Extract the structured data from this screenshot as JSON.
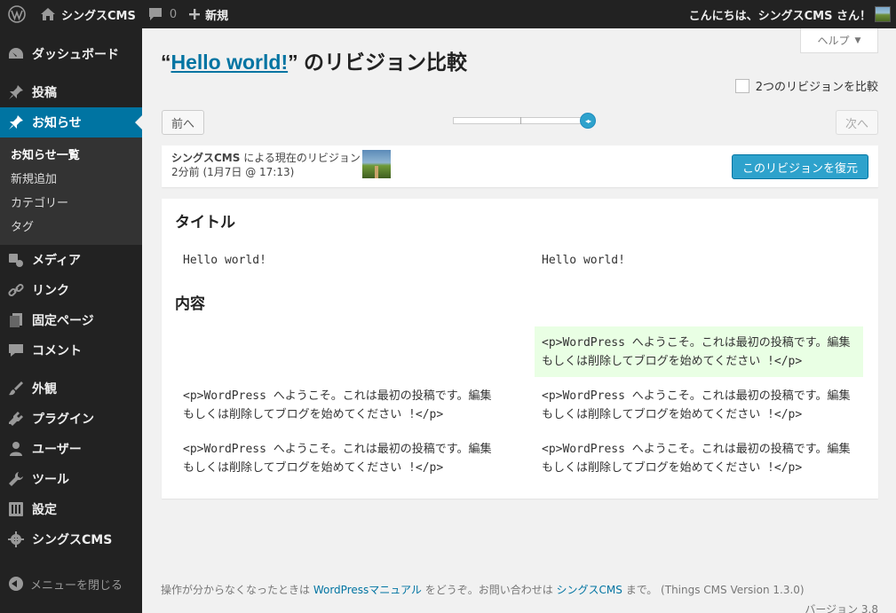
{
  "adminbar": {
    "site_name": "シングスCMS",
    "comment_count": "0",
    "new_label": "新規",
    "greeting": "こんにちは、シングスCMS さん！"
  },
  "sidebar": {
    "items": [
      {
        "label": "ダッシュボード",
        "icon": "dashboard-icon"
      },
      {
        "label": "投稿",
        "icon": "pin-icon"
      },
      {
        "label": "お知らせ",
        "icon": "pin-icon"
      },
      {
        "label": "メディア",
        "icon": "media-icon"
      },
      {
        "label": "リンク",
        "icon": "link-icon"
      },
      {
        "label": "固定ページ",
        "icon": "page-icon"
      },
      {
        "label": "コメント",
        "icon": "comment-icon"
      },
      {
        "label": "外観",
        "icon": "appearance-icon"
      },
      {
        "label": "プラグイン",
        "icon": "plugin-icon"
      },
      {
        "label": "ユーザー",
        "icon": "user-icon"
      },
      {
        "label": "ツール",
        "icon": "tools-icon"
      },
      {
        "label": "設定",
        "icon": "settings-icon"
      },
      {
        "label": "シングスCMS",
        "icon": "gear-icon"
      }
    ],
    "submenu": [
      "お知らせ一覧",
      "新規追加",
      "カテゴリー",
      "タグ"
    ],
    "collapse_label": "メニューを閉じる"
  },
  "header": {
    "help_label": "ヘルプ",
    "title_open_quote": "“",
    "title_link": "Hello world!",
    "title_rest": "” のリビジョン比較",
    "compare_two_label": "2つのリビジョンを比較"
  },
  "nav": {
    "prev_label": "前へ",
    "next_label": "次へ"
  },
  "revision": {
    "author": "シングスCMS",
    "author_suffix": " による現在のリビジョン",
    "time": "2分前 (1月7日 @ 17:13)",
    "restore_label": "このリビジョンを復元"
  },
  "diff": {
    "title_heading": "タイトル",
    "title_left": "Hello world!",
    "title_right": "Hello world!",
    "content_heading": "内容",
    "added_right": "<p>WordPress へようこそ。これは最初の投稿です。編集もしくは削除してブログを始めてください !</p>",
    "row2_left": "<p>WordPress へようこそ。これは最初の投稿です。編集もしくは削除してブログを始めてください !</p>",
    "row2_right": "<p>WordPress へようこそ。これは最初の投稿です。編集もしくは削除してブログを始めてください !</p>",
    "row3_left": "<p>WordPress へようこそ。これは最初の投稿です。編集もしくは削除してブログを始めてください !</p>",
    "row3_right": "<p>WordPress へようこそ。これは最初の投稿です。編集もしくは削除してブログを始めてください !</p>"
  },
  "footer": {
    "text1": "操作が分からなくなったときは ",
    "link1": "WordPressマニュアル",
    "text2": " をどうぞ。お問い合わせは ",
    "link2": "シングスCMS",
    "text3": " まで。 (Things CMS Version 1.3.0)",
    "version": "バージョン 3.8"
  },
  "colors": {
    "accent": "#0074a2",
    "button_primary": "#2ea2cc",
    "added_bg": "#e9ffe4",
    "sidebar_bg": "#222222"
  }
}
